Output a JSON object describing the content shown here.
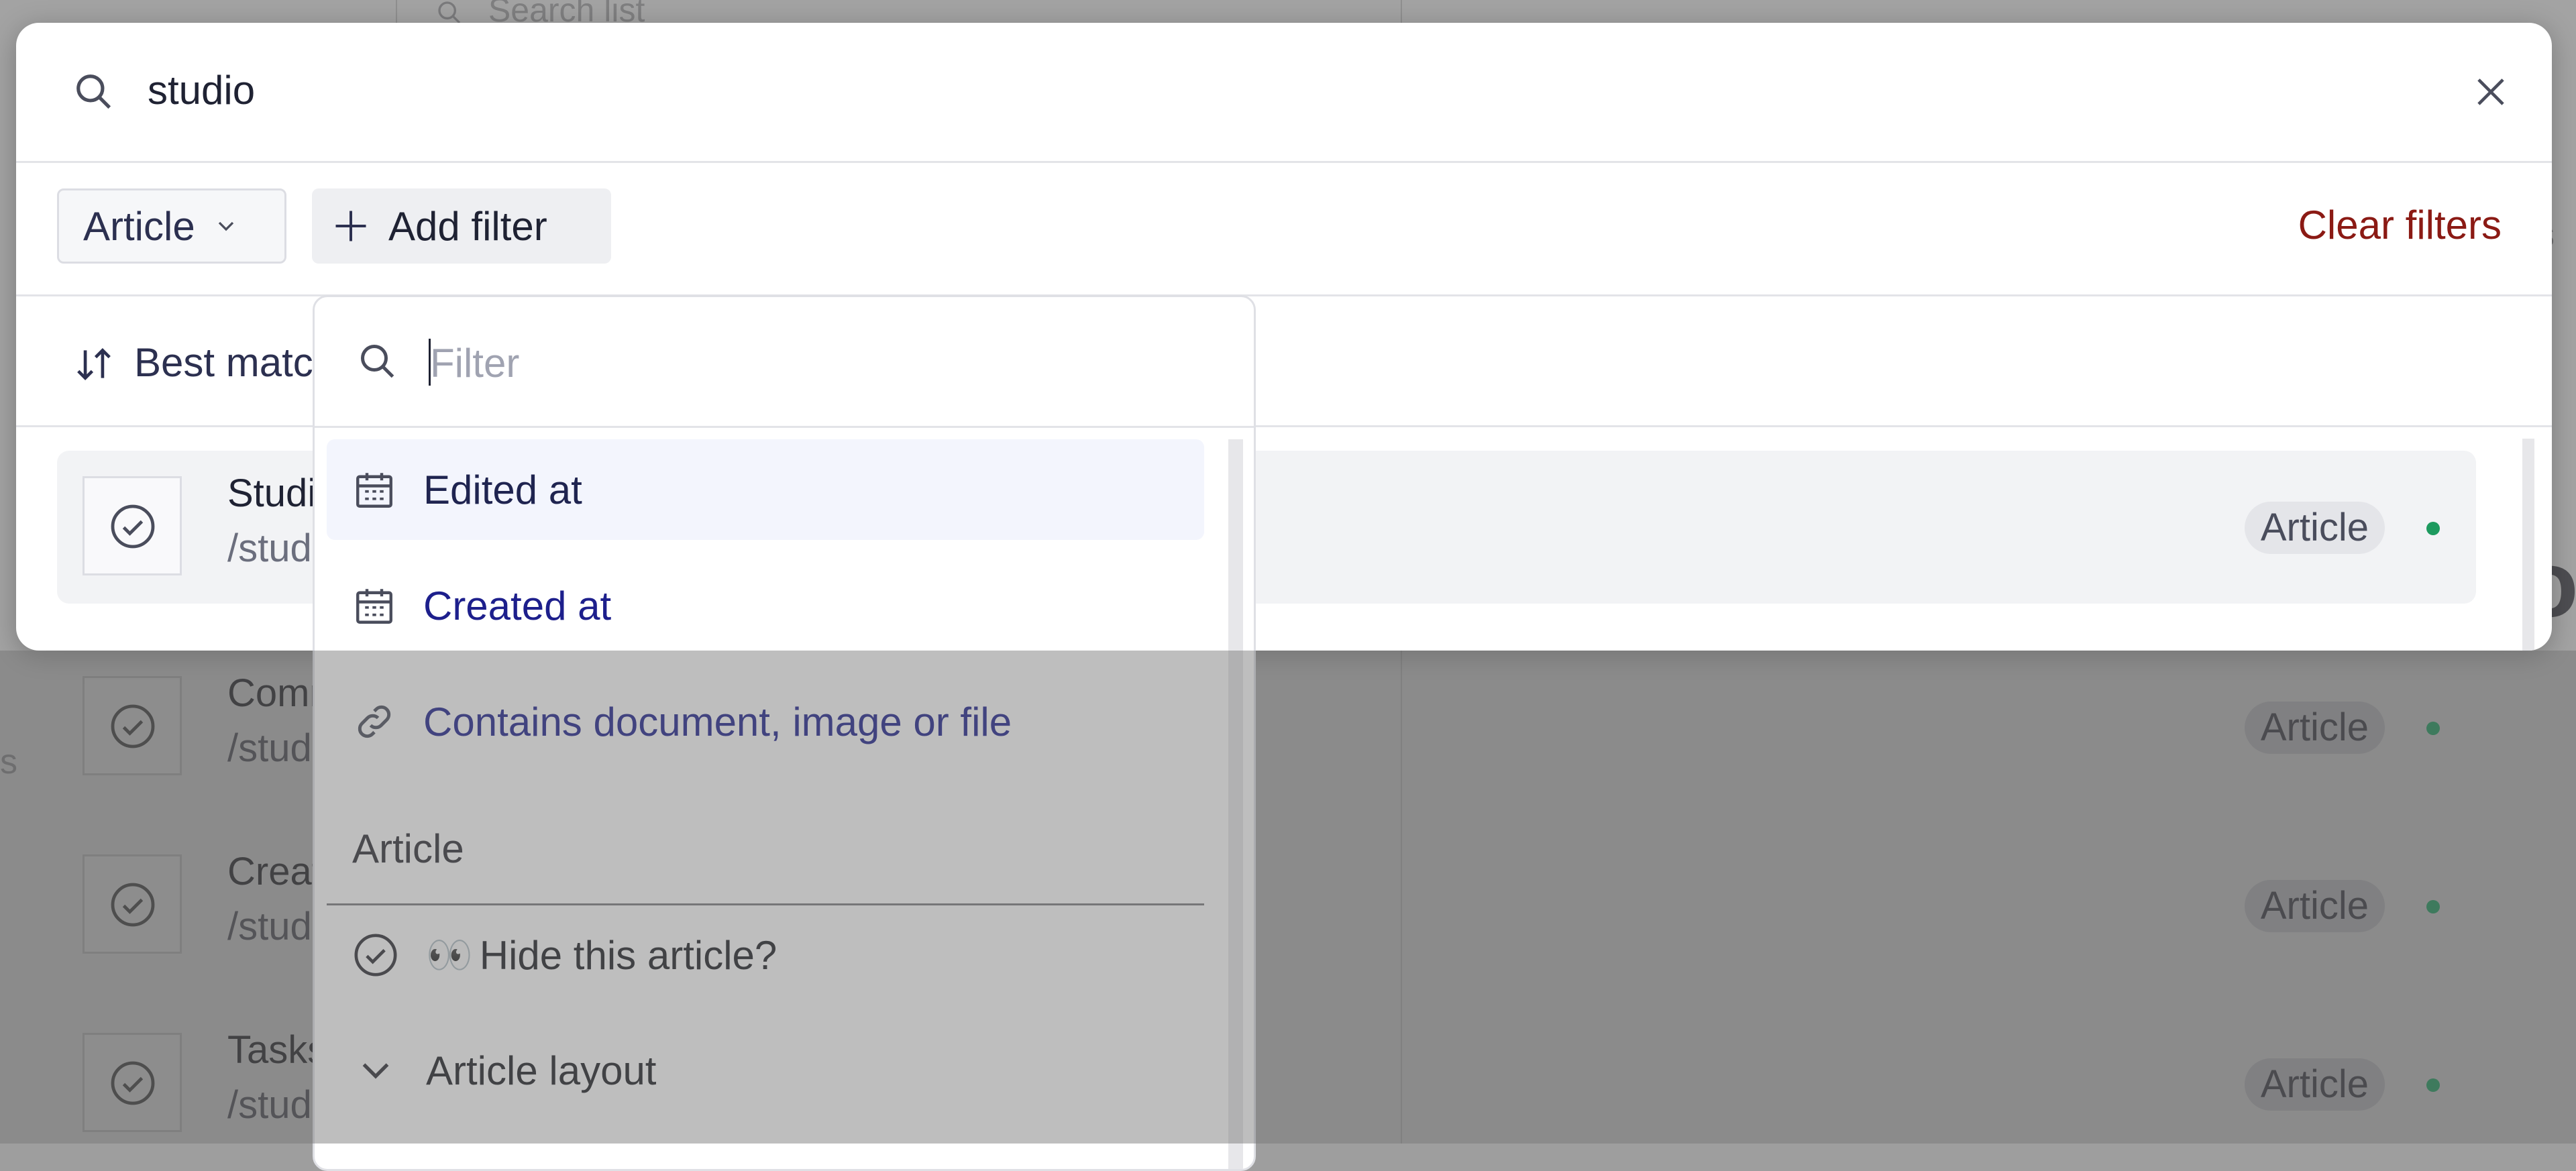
{
  "background": {
    "search_placeholder": "Search list",
    "edge_text_right": "s",
    "edge_text_left": "s",
    "edge_text_big": "oa"
  },
  "search": {
    "query": "studio",
    "search_icon": "search-icon",
    "close_icon": "close-icon"
  },
  "filters": {
    "type_chip": "Article",
    "add_filter": "Add filter",
    "clear_filters": "Clear filters",
    "clear_color": "#8b1a14"
  },
  "sort": {
    "label": "Best matc"
  },
  "results": [
    {
      "title": "Studi",
      "path": "/stud",
      "badge": "Article"
    },
    {
      "title": "Comm",
      "path": "/stud",
      "badge": "Article"
    },
    {
      "title": "Creat",
      "path": "/stud",
      "badge": "Article"
    },
    {
      "title": "Tasks",
      "path": "/stud",
      "badge": "Article"
    }
  ],
  "popover": {
    "placeholder": "Filter",
    "items": [
      {
        "label": "Edited at",
        "icon": "calendar-icon"
      },
      {
        "label": "Created at",
        "icon": "calendar-icon"
      },
      {
        "label": "Contains document, image or file",
        "icon": "link-icon"
      }
    ],
    "section": "Article",
    "section_items": [
      {
        "emoji": "👀",
        "label": "Hide this article?",
        "icon": "check-circle-icon"
      },
      {
        "label": "Article layout",
        "icon": "chevron-down-icon"
      }
    ]
  },
  "colors": {
    "link_blue": "#1d1f8c",
    "status_dot": "#1d9a5e"
  }
}
